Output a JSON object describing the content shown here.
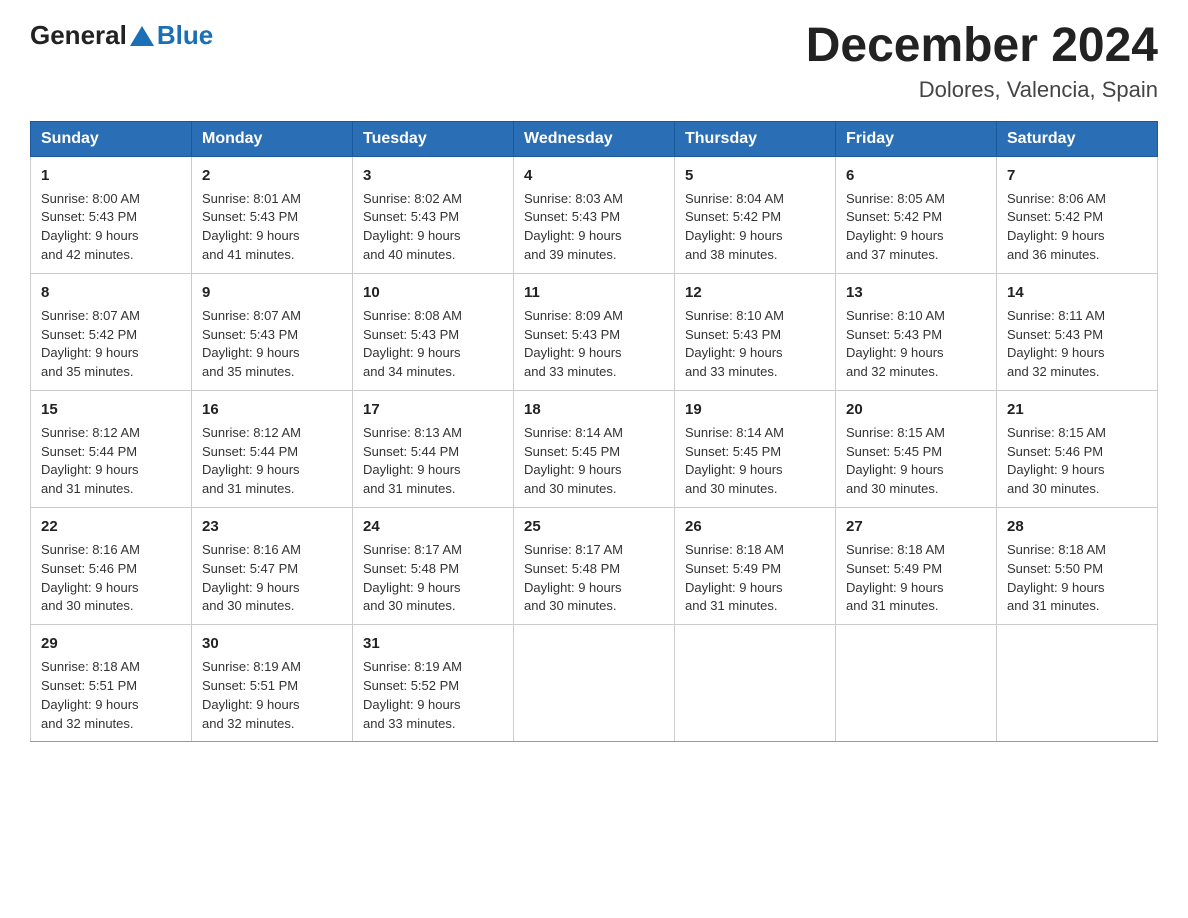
{
  "header": {
    "logo_general": "General",
    "logo_blue": "Blue",
    "month_title": "December 2024",
    "subtitle": "Dolores, Valencia, Spain"
  },
  "weekdays": [
    "Sunday",
    "Monday",
    "Tuesday",
    "Wednesday",
    "Thursday",
    "Friday",
    "Saturday"
  ],
  "weeks": [
    [
      {
        "day": "1",
        "info": "Sunrise: 8:00 AM\nSunset: 5:43 PM\nDaylight: 9 hours\nand 42 minutes."
      },
      {
        "day": "2",
        "info": "Sunrise: 8:01 AM\nSunset: 5:43 PM\nDaylight: 9 hours\nand 41 minutes."
      },
      {
        "day": "3",
        "info": "Sunrise: 8:02 AM\nSunset: 5:43 PM\nDaylight: 9 hours\nand 40 minutes."
      },
      {
        "day": "4",
        "info": "Sunrise: 8:03 AM\nSunset: 5:43 PM\nDaylight: 9 hours\nand 39 minutes."
      },
      {
        "day": "5",
        "info": "Sunrise: 8:04 AM\nSunset: 5:42 PM\nDaylight: 9 hours\nand 38 minutes."
      },
      {
        "day": "6",
        "info": "Sunrise: 8:05 AM\nSunset: 5:42 PM\nDaylight: 9 hours\nand 37 minutes."
      },
      {
        "day": "7",
        "info": "Sunrise: 8:06 AM\nSunset: 5:42 PM\nDaylight: 9 hours\nand 36 minutes."
      }
    ],
    [
      {
        "day": "8",
        "info": "Sunrise: 8:07 AM\nSunset: 5:42 PM\nDaylight: 9 hours\nand 35 minutes."
      },
      {
        "day": "9",
        "info": "Sunrise: 8:07 AM\nSunset: 5:43 PM\nDaylight: 9 hours\nand 35 minutes."
      },
      {
        "day": "10",
        "info": "Sunrise: 8:08 AM\nSunset: 5:43 PM\nDaylight: 9 hours\nand 34 minutes."
      },
      {
        "day": "11",
        "info": "Sunrise: 8:09 AM\nSunset: 5:43 PM\nDaylight: 9 hours\nand 33 minutes."
      },
      {
        "day": "12",
        "info": "Sunrise: 8:10 AM\nSunset: 5:43 PM\nDaylight: 9 hours\nand 33 minutes."
      },
      {
        "day": "13",
        "info": "Sunrise: 8:10 AM\nSunset: 5:43 PM\nDaylight: 9 hours\nand 32 minutes."
      },
      {
        "day": "14",
        "info": "Sunrise: 8:11 AM\nSunset: 5:43 PM\nDaylight: 9 hours\nand 32 minutes."
      }
    ],
    [
      {
        "day": "15",
        "info": "Sunrise: 8:12 AM\nSunset: 5:44 PM\nDaylight: 9 hours\nand 31 minutes."
      },
      {
        "day": "16",
        "info": "Sunrise: 8:12 AM\nSunset: 5:44 PM\nDaylight: 9 hours\nand 31 minutes."
      },
      {
        "day": "17",
        "info": "Sunrise: 8:13 AM\nSunset: 5:44 PM\nDaylight: 9 hours\nand 31 minutes."
      },
      {
        "day": "18",
        "info": "Sunrise: 8:14 AM\nSunset: 5:45 PM\nDaylight: 9 hours\nand 30 minutes."
      },
      {
        "day": "19",
        "info": "Sunrise: 8:14 AM\nSunset: 5:45 PM\nDaylight: 9 hours\nand 30 minutes."
      },
      {
        "day": "20",
        "info": "Sunrise: 8:15 AM\nSunset: 5:45 PM\nDaylight: 9 hours\nand 30 minutes."
      },
      {
        "day": "21",
        "info": "Sunrise: 8:15 AM\nSunset: 5:46 PM\nDaylight: 9 hours\nand 30 minutes."
      }
    ],
    [
      {
        "day": "22",
        "info": "Sunrise: 8:16 AM\nSunset: 5:46 PM\nDaylight: 9 hours\nand 30 minutes."
      },
      {
        "day": "23",
        "info": "Sunrise: 8:16 AM\nSunset: 5:47 PM\nDaylight: 9 hours\nand 30 minutes."
      },
      {
        "day": "24",
        "info": "Sunrise: 8:17 AM\nSunset: 5:48 PM\nDaylight: 9 hours\nand 30 minutes."
      },
      {
        "day": "25",
        "info": "Sunrise: 8:17 AM\nSunset: 5:48 PM\nDaylight: 9 hours\nand 30 minutes."
      },
      {
        "day": "26",
        "info": "Sunrise: 8:18 AM\nSunset: 5:49 PM\nDaylight: 9 hours\nand 31 minutes."
      },
      {
        "day": "27",
        "info": "Sunrise: 8:18 AM\nSunset: 5:49 PM\nDaylight: 9 hours\nand 31 minutes."
      },
      {
        "day": "28",
        "info": "Sunrise: 8:18 AM\nSunset: 5:50 PM\nDaylight: 9 hours\nand 31 minutes."
      }
    ],
    [
      {
        "day": "29",
        "info": "Sunrise: 8:18 AM\nSunset: 5:51 PM\nDaylight: 9 hours\nand 32 minutes."
      },
      {
        "day": "30",
        "info": "Sunrise: 8:19 AM\nSunset: 5:51 PM\nDaylight: 9 hours\nand 32 minutes."
      },
      {
        "day": "31",
        "info": "Sunrise: 8:19 AM\nSunset: 5:52 PM\nDaylight: 9 hours\nand 33 minutes."
      },
      {
        "day": "",
        "info": ""
      },
      {
        "day": "",
        "info": ""
      },
      {
        "day": "",
        "info": ""
      },
      {
        "day": "",
        "info": ""
      }
    ]
  ]
}
